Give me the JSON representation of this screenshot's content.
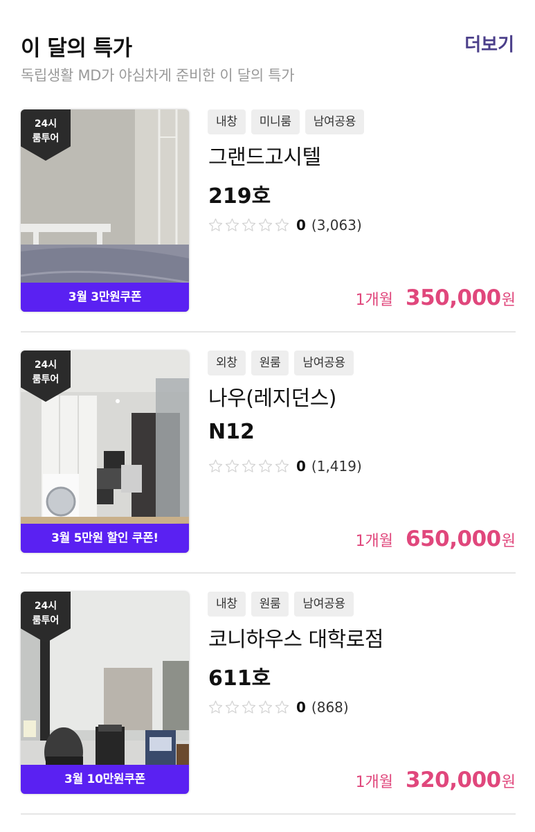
{
  "header": {
    "title": "이 달의 특가",
    "more_label": "더보기",
    "subtitle": "독립생활 MD가 야심차게 준비한 이 달의 특가"
  },
  "colors": {
    "accent": "#4b3f8a",
    "coupon_bg": "#5a21f2",
    "price": "#e0477c",
    "badge_bg": "#2b2b2b"
  },
  "icons": {
    "star": "star-outline-icon"
  },
  "listings": [
    {
      "badge_line1": "24시",
      "badge_line2": "룸투어",
      "coupon": "3월 3만원쿠폰",
      "tags": [
        "내창",
        "미니룸",
        "남여공용"
      ],
      "name": "그랜드고시텔",
      "room": "219호",
      "rating": "0",
      "rating_fraction": 0,
      "reviews": "(3,063)",
      "period": "1개월",
      "price": "350,000",
      "currency": "원"
    },
    {
      "badge_line1": "24시",
      "badge_line2": "룸투어",
      "coupon": "3월 5만원 할인 쿠폰!",
      "tags": [
        "외창",
        "원룸",
        "남여공용"
      ],
      "name": "나우(레지던스)",
      "room": "N12",
      "rating": "0",
      "rating_fraction": 0,
      "reviews": "(1,419)",
      "period": "1개월",
      "price": "650,000",
      "currency": "원"
    },
    {
      "badge_line1": "24시",
      "badge_line2": "룸투어",
      "coupon": "3월 10만원쿠폰",
      "tags": [
        "내창",
        "원룸",
        "남여공용"
      ],
      "name": "코니하우스 대학로점",
      "room": "611호",
      "rating": "0",
      "rating_fraction": 0,
      "reviews": "(868)",
      "period": "1개월",
      "price": "320,000",
      "currency": "원"
    }
  ]
}
